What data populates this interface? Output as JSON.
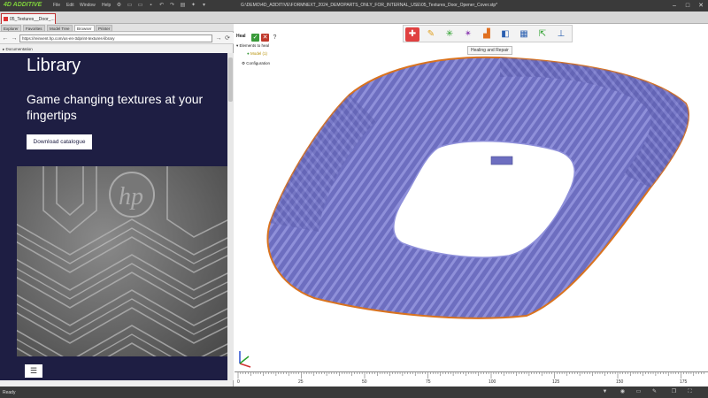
{
  "app": {
    "logo": "4D ADDITIVE",
    "menu": [
      "File",
      "Edit",
      "Window",
      "Help"
    ],
    "window_title": "G:\\DEMO\\4D_ADDITIVE\\FORMNEXT_2024_DEMOPARTS_ONLY_FOR_INTERNAL_USE\\05_Textures_Door_Opener_Cover.stp*"
  },
  "document_tab": {
    "label": "05_Textures__Door_..."
  },
  "left_panel": {
    "tabs": [
      "Explorer",
      "Favorites",
      "Model Tree",
      "Browser",
      "Printer"
    ],
    "active_tab": 3,
    "url": "https://reinvent.hp.com/us-en-3dprint-textures-library",
    "documentation_label": "Documentation"
  },
  "web": {
    "library_heading": "Library",
    "headline": "Game changing textures at your fingertips",
    "download_button": "Download catalogue",
    "menu_glyph": "☰"
  },
  "heal_panel": {
    "title": "Heal",
    "elements_label": "Elements to heal",
    "model_item": "Model (1)",
    "configuration_label": "Configuration"
  },
  "toolbar": {
    "tooltip": "Healing and Repair",
    "icons": [
      "heal-icon",
      "fix-icon",
      "sparkle-icon",
      "explode-icon",
      "analysis-icon",
      "shell-icon",
      "layout-icon",
      "export-icon",
      "support-icon"
    ]
  },
  "ruler": {
    "labels": [
      "0",
      "25",
      "50",
      "75",
      "100",
      "125",
      "150",
      "175"
    ]
  },
  "status": {
    "text": "Ready"
  },
  "colors": {
    "model": "#6d6ec0",
    "model_edge": "#d9731f",
    "web_bg": "#1e1e43",
    "accent_green": "#7fd13b"
  }
}
